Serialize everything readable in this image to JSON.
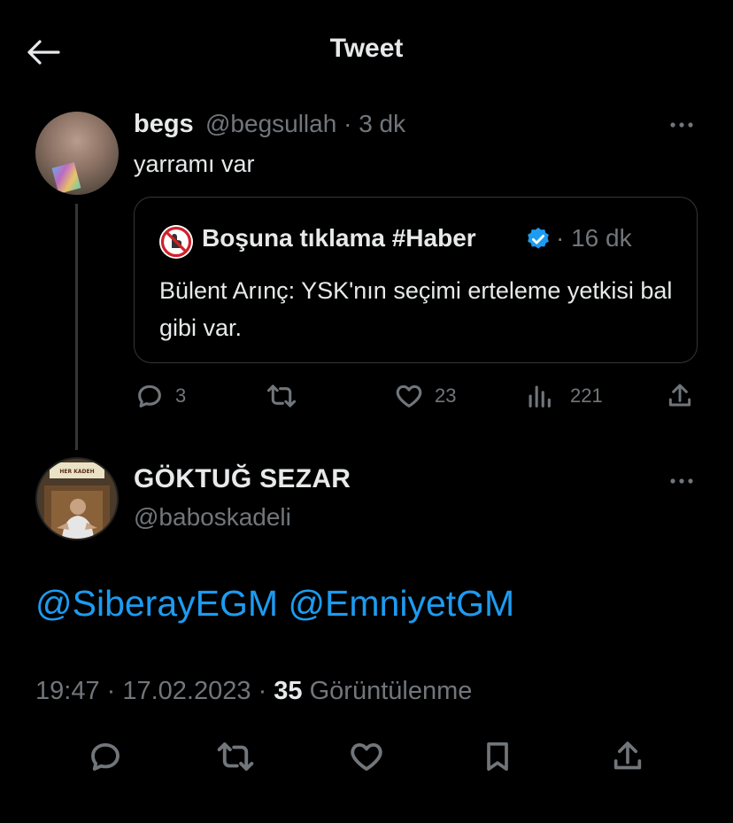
{
  "header": {
    "title": "Tweet",
    "back_icon": "arrow-left-icon"
  },
  "tweet1": {
    "display_name": "begs",
    "handle": "@begsullah",
    "time": "3 dk",
    "text": "yarramı var",
    "quote": {
      "display_name": "Boşuna tıklama #Haber",
      "verified": true,
      "time": "16 dk",
      "text": "Bülent Arınç: YSK'nın seçimi erteleme yetkisi bal gibi var."
    },
    "actions": {
      "replies": "3",
      "retweets": "",
      "likes": "23",
      "views": "221"
    }
  },
  "tweet2": {
    "display_name": "GÖKTUĞ SEZAR",
    "handle": "@baboskadeli",
    "avatar_sign_text": "HER KADEH",
    "mentions": [
      "@SiberayEGM",
      "@EmniyetGM"
    ],
    "time": "19:47",
    "date": "17.02.2023",
    "views_count": "35",
    "views_label": "Görüntülenme"
  },
  "colors": {
    "background": "#000000",
    "text": "#e7e9ea",
    "muted": "#71767b",
    "link": "#1d9bf0",
    "border": "#333639",
    "verified": "#1d9bf0"
  }
}
